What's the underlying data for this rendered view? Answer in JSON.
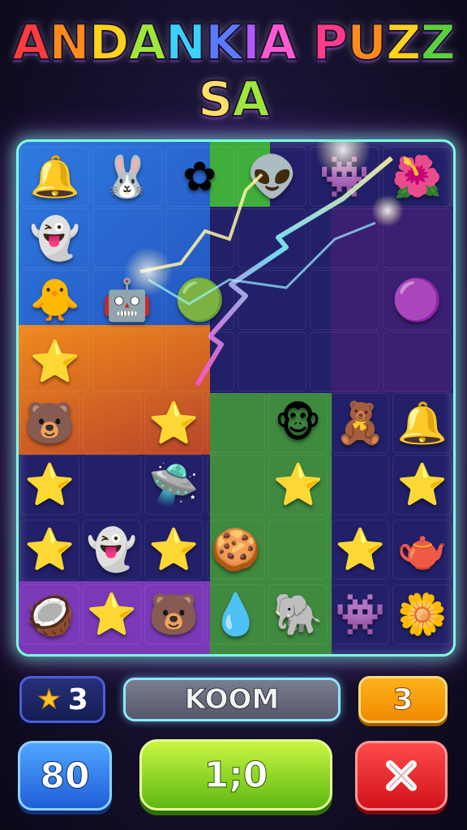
{
  "title": {
    "text": "ANDANKIA PUZZSA",
    "letters": [
      {
        "ch": "A",
        "color": "#ff3b3b"
      },
      {
        "ch": "N",
        "color": "#ff8a1c"
      },
      {
        "ch": "D",
        "color": "#ffd21c"
      },
      {
        "ch": "A",
        "color": "#9fe83a"
      },
      {
        "ch": "N",
        "color": "#3ad1ff"
      },
      {
        "ch": "K",
        "color": "#5a7bff"
      },
      {
        "ch": "I",
        "color": "#b25aff"
      },
      {
        "ch": "A",
        "color": "#ff5ad2"
      },
      {
        "ch": " ",
        "color": "#ffffff"
      },
      {
        "ch": "P",
        "color": "#ff3b8a"
      },
      {
        "ch": "U",
        "color": "#ff8a1c"
      },
      {
        "ch": "Z",
        "color": "#ffd21c"
      },
      {
        "ch": "Z",
        "color": "#5ad13a"
      },
      {
        "ch": "S",
        "color": "#ffe066"
      },
      {
        "ch": "A",
        "color": "#9fe83a"
      }
    ]
  },
  "board": {
    "accent": "#7fffe0",
    "cells": [
      {
        "icon": "bell-icon",
        "emoji": "🔔",
        "bg": "#2a6fd0"
      },
      {
        "icon": "bunny-blob-icon",
        "emoji": "🐰",
        "bg": "#2a6fd0"
      },
      {
        "icon": "tiny-flowers-icon",
        "emoji": "✿",
        "bg": "#3fae3a"
      },
      {
        "icon": "green-alien-icon",
        "emoji": "👽",
        "bg": "#2a6fd0"
      },
      {
        "icon": "pink-gear-monster-icon",
        "emoji": "👾",
        "bg": "#e0751c"
      },
      {
        "icon": "red-flower-monster-icon",
        "emoji": "🌺",
        "bg": "#38b040"
      },
      {
        "icon": "yellow-ghost-icon",
        "emoji": "👻",
        "bg": "#2a6fd0"
      },
      {
        "icon": "empty-icon",
        "emoji": "",
        "bg": "#2a6fd0"
      },
      {
        "icon": "empty-icon",
        "emoji": "",
        "bg": "#d2582a"
      },
      {
        "icon": "empty-icon",
        "emoji": "",
        "bg": "#3a2a8a"
      },
      {
        "icon": "empty-icon",
        "emoji": "",
        "bg": "#3a1f72"
      },
      {
        "icon": "empty-icon",
        "emoji": "",
        "bg": "#3a1f72"
      },
      {
        "icon": "chick-bowl-icon",
        "emoji": "🐥",
        "bg": "#2a6fd0"
      },
      {
        "icon": "purple-robot-icon",
        "emoji": "🤖",
        "bg": "#4a3ab0"
      },
      {
        "icon": "green-slime-icon",
        "emoji": "🟢",
        "bg": "#d2582a"
      },
      {
        "icon": "empty-icon",
        "emoji": "",
        "bg": "#3a2a8a"
      },
      {
        "icon": "empty-icon",
        "emoji": "",
        "bg": "#3a1f72"
      },
      {
        "icon": "purple-bunny-icon",
        "emoji": "🟣",
        "bg": "#3a1f72"
      },
      {
        "icon": "red-star-face-icon",
        "emoji": "⭐",
        "bg": "#e0751c"
      },
      {
        "icon": "empty-icon",
        "emoji": "",
        "bg": "#b8452a"
      },
      {
        "icon": "empty-icon",
        "emoji": "",
        "bg": "#5a2fa0"
      },
      {
        "icon": "empty-icon",
        "emoji": "",
        "bg": "#3a2a8a"
      },
      {
        "icon": "empty-icon",
        "emoji": "",
        "bg": "#3a1f72"
      },
      {
        "icon": "empty-icon",
        "emoji": "",
        "bg": "#3a1f72"
      },
      {
        "icon": "brown-bear-icon",
        "emoji": "🐻",
        "bg": "#e0751c"
      },
      {
        "icon": "empty-icon",
        "emoji": "",
        "bg": "#3a2f8a"
      },
      {
        "icon": "yellow-star-icon",
        "emoji": "⭐",
        "bg": "#3a2f8a"
      },
      {
        "icon": "empty-icon",
        "emoji": "",
        "bg": "#3f8a3f"
      },
      {
        "icon": "pink-monkey-icon",
        "emoji": "🐵",
        "bg": "#3a2a8a"
      },
      {
        "icon": "bear-cub-icon",
        "emoji": "🧸",
        "bg": "#2a2260"
      },
      {
        "icon": "red-bell-icon",
        "emoji": "🔔",
        "bg": "#2a2260"
      },
      {
        "icon": "red-star-icon",
        "emoji": "⭐",
        "bg": "#e0751c"
      },
      {
        "icon": "empty-icon",
        "emoji": "",
        "bg": "#3a2f8a"
      },
      {
        "icon": "ufo-icon",
        "emoji": "🛸",
        "bg": "#3a2f8a"
      },
      {
        "icon": "empty-icon",
        "emoji": "",
        "bg": "#3f8a3f"
      },
      {
        "icon": "green-star-icon",
        "emoji": "⭐",
        "bg": "#3f8a3f"
      },
      {
        "icon": "empty-icon",
        "emoji": "",
        "bg": "#2a2260"
      },
      {
        "icon": "purple-star-icon",
        "emoji": "⭐",
        "bg": "#2a2260"
      },
      {
        "icon": "yellow-star-icon",
        "emoji": "⭐",
        "bg": "#ff8a1c"
      },
      {
        "icon": "green-ghost-icon",
        "emoji": "👻",
        "bg": "#3fae3a"
      },
      {
        "icon": "green-star-icon",
        "emoji": "⭐",
        "bg": "#2a2a70"
      },
      {
        "icon": "orange-cookie-icon",
        "emoji": "🍪",
        "bg": "#3f8a3f"
      },
      {
        "icon": "empty-icon",
        "emoji": "",
        "bg": "#3f8a3f"
      },
      {
        "icon": "orange-star-icon",
        "emoji": "⭐",
        "bg": "#2a2260"
      },
      {
        "icon": "blue-watering-can-icon",
        "emoji": "🫖",
        "bg": "#2a2260"
      },
      {
        "icon": "brown-coconut-icon",
        "emoji": "🥥",
        "bg": "#7a3ab8"
      },
      {
        "icon": "pink-star-icon",
        "emoji": "⭐",
        "bg": "#7a3ab8"
      },
      {
        "icon": "orange-bear-icon",
        "emoji": "🐻",
        "bg": "#7a3ab8"
      },
      {
        "icon": "grey-drop-icon",
        "emoji": "💧",
        "bg": "#2a2260"
      },
      {
        "icon": "blue-elephant-icon",
        "emoji": "🐘",
        "bg": "#3f8a3f"
      },
      {
        "icon": "purple-gear-icon",
        "emoji": "👾",
        "bg": "#2a2260"
      },
      {
        "icon": "green-flower-icon",
        "emoji": "🌼",
        "bg": "#2a2260"
      }
    ]
  },
  "hud": {
    "stars_count": "3",
    "star_icon": "star-icon",
    "label": "KOOM",
    "count": "3",
    "score": "80",
    "timer": "1;0",
    "close_symbol": "✕"
  }
}
